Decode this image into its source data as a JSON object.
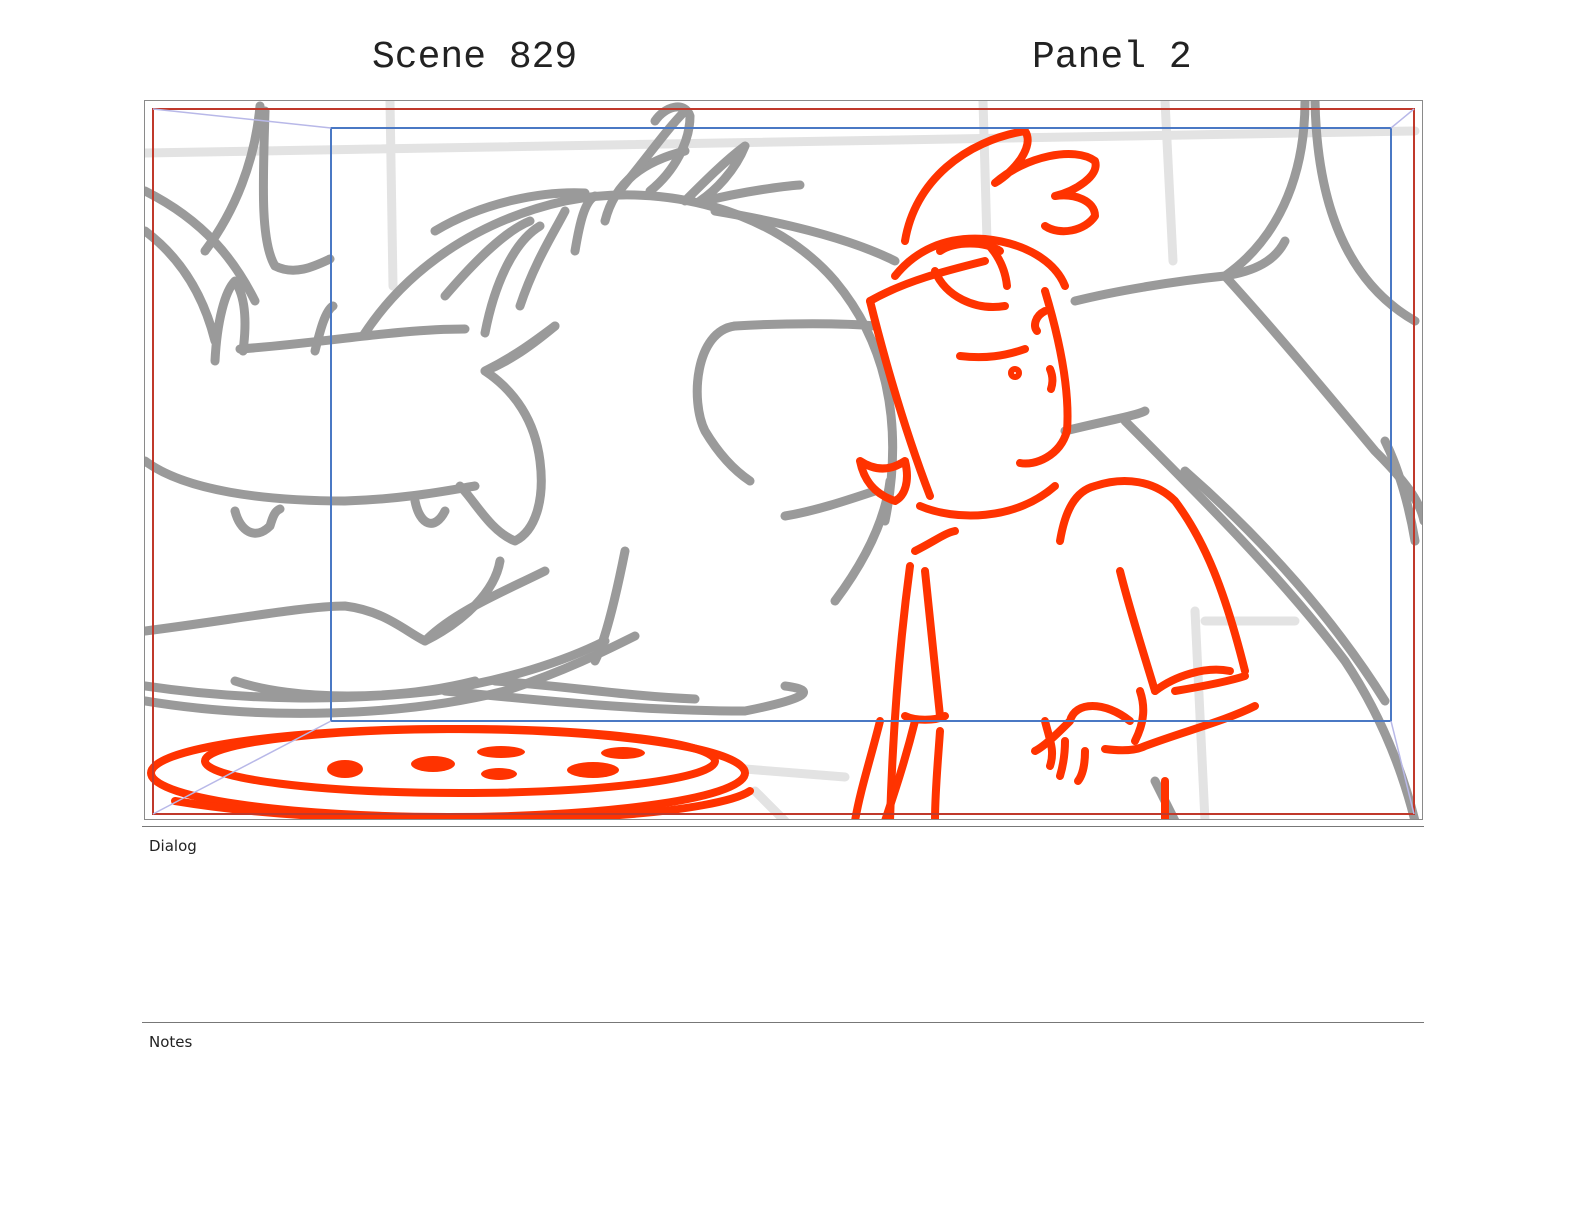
{
  "header": {
    "scene": "Scene 829",
    "panel": "Panel 2"
  },
  "sections": {
    "dialog_label": "Dialog",
    "notes_label": "Notes"
  },
  "colors": {
    "sketch_gray": "#9a9a9a",
    "sketch_light": "#e2e2e2",
    "sketch_red": "#ff3300",
    "safe_frame_red": "#c0392b",
    "safe_frame_blue": "#4a78c4"
  },
  "artwork": {
    "subject": "storyboard sketch",
    "icon": "storyboard-sketch-image"
  }
}
